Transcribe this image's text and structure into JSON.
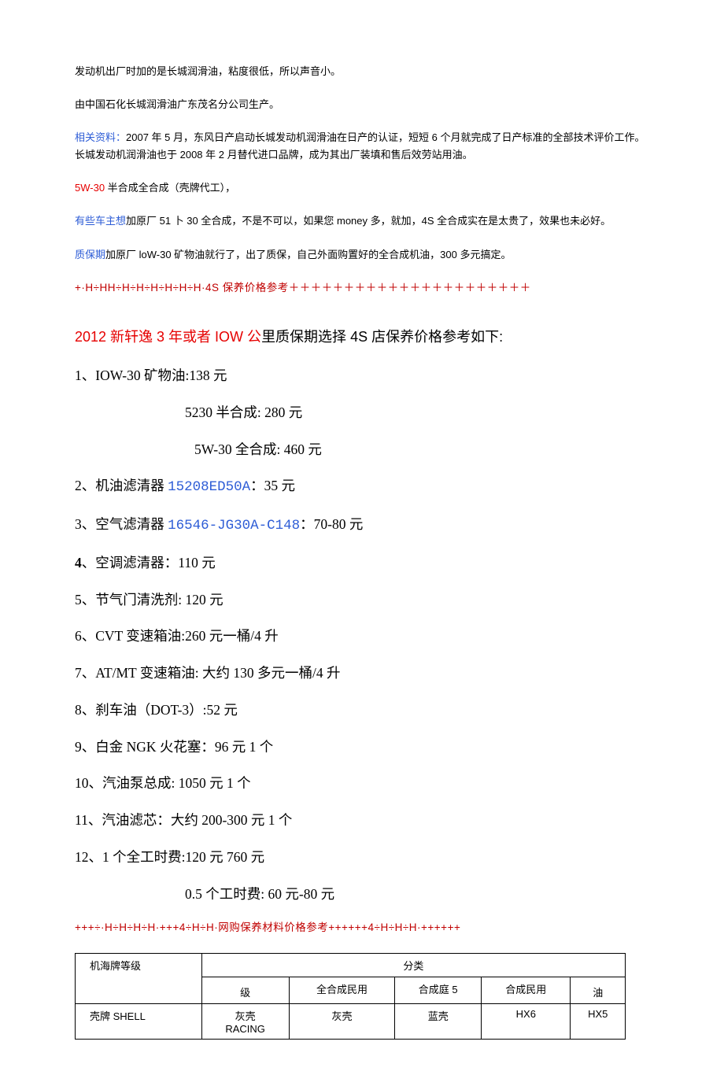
{
  "para1": "发动机出厂时加的是长城润滑油，粘度很低，所以声音小。",
  "para2": "由中国石化长城润滑油广东茂名分公司生产。",
  "para3_label": "相关资料：",
  "para3_text": "2007 年 5 月，东风日产启动长城发动机润滑油在日产的认证，短短 6 个月就完成了日产标准的全部技术评价工作。长城发动机润滑油也于 2008 年 2 月替代进口品牌，成为其出厂装填和售后效劳站用油。",
  "para4_red": "5W-30",
  "para4_text": " 半合成全合成（壳牌代工），",
  "para5_label": "有些车主想",
  "para5_text": "加原厂 51 卜 30 全合成，不是不可以，如果您 money 多，就加，4S 全合成实在是太贵了，效果也未必好。",
  "para6_label": "质保期",
  "para6_text": "加原厂 loW-30 矿物油就行了，出了质保，自己外面购置好的全合成机油，300 多元搞定。",
  "divider1": "+·H÷HH÷H÷H÷H÷H÷H÷H·4S 保养价格参考＋＋＋＋＋＋＋＋＋＋＋＋＋＋＋＋＋＋＋＋＋＋",
  "section_title_red1": "2012 新轩逸 3 年或者 IOW 公",
  "section_title_black": "里质保期选择 4S 店保养价格参考如下:",
  "items": {
    "i1": "1、IOW-30 矿物油:138 元",
    "i1a": "5230 半合成: 280 元",
    "i1b": "5W-30 全合成: 460 元",
    "i2_pre": "2、机油滤清器 ",
    "i2_blue": "15208ED50A",
    "i2_post": "：35 元",
    "i3_pre": "3、空气滤清器 ",
    "i3_blue": "16546-JG30A-C148",
    "i3_post": "：70-80 元",
    "i4_pre": "4",
    "i4_post": "、空调滤清器：110 元",
    "i5": "5、节气门清洗剂: 120 元",
    "i6": "6、CVT 变速箱油:260 元一桶/4 升",
    "i7": "7、AT/MT 变速箱油: 大约 130 多元一桶/4 升",
    "i8": "8、刹车油（DOT-3）:52 元",
    "i9": "9、白金 NGK 火花塞：96 元 1 个",
    "i10": "10、汽油泵总成: 1050 元 1 个",
    "i11": "11、汽油滤芯：大约 200-300 元 1 个",
    "i12": "12、1 个全工时费:120 元 760 元",
    "i12a": "0.5 个工时费: 60 元-80 元"
  },
  "divider2": "+++÷·H÷H÷H÷H·+++4÷H÷H·网购保养材料价格参考++++++4÷H÷H÷H·++++++",
  "table": {
    "h1": "机海牌等级",
    "h2": "分类",
    "c1": "",
    "c2": "全合成民用",
    "c3": "合成庭 5",
    "c4": "合成民用",
    "c5": "",
    "s1": "级",
    "s5": "油",
    "r2_brand": "壳牌 SHELL",
    "r2_1a": "灰壳",
    "r2_1b": "RACING",
    "r2_2": "灰壳",
    "r2_3": "蓝壳",
    "r2_4": "HX6",
    "r2_5": "HX5"
  }
}
